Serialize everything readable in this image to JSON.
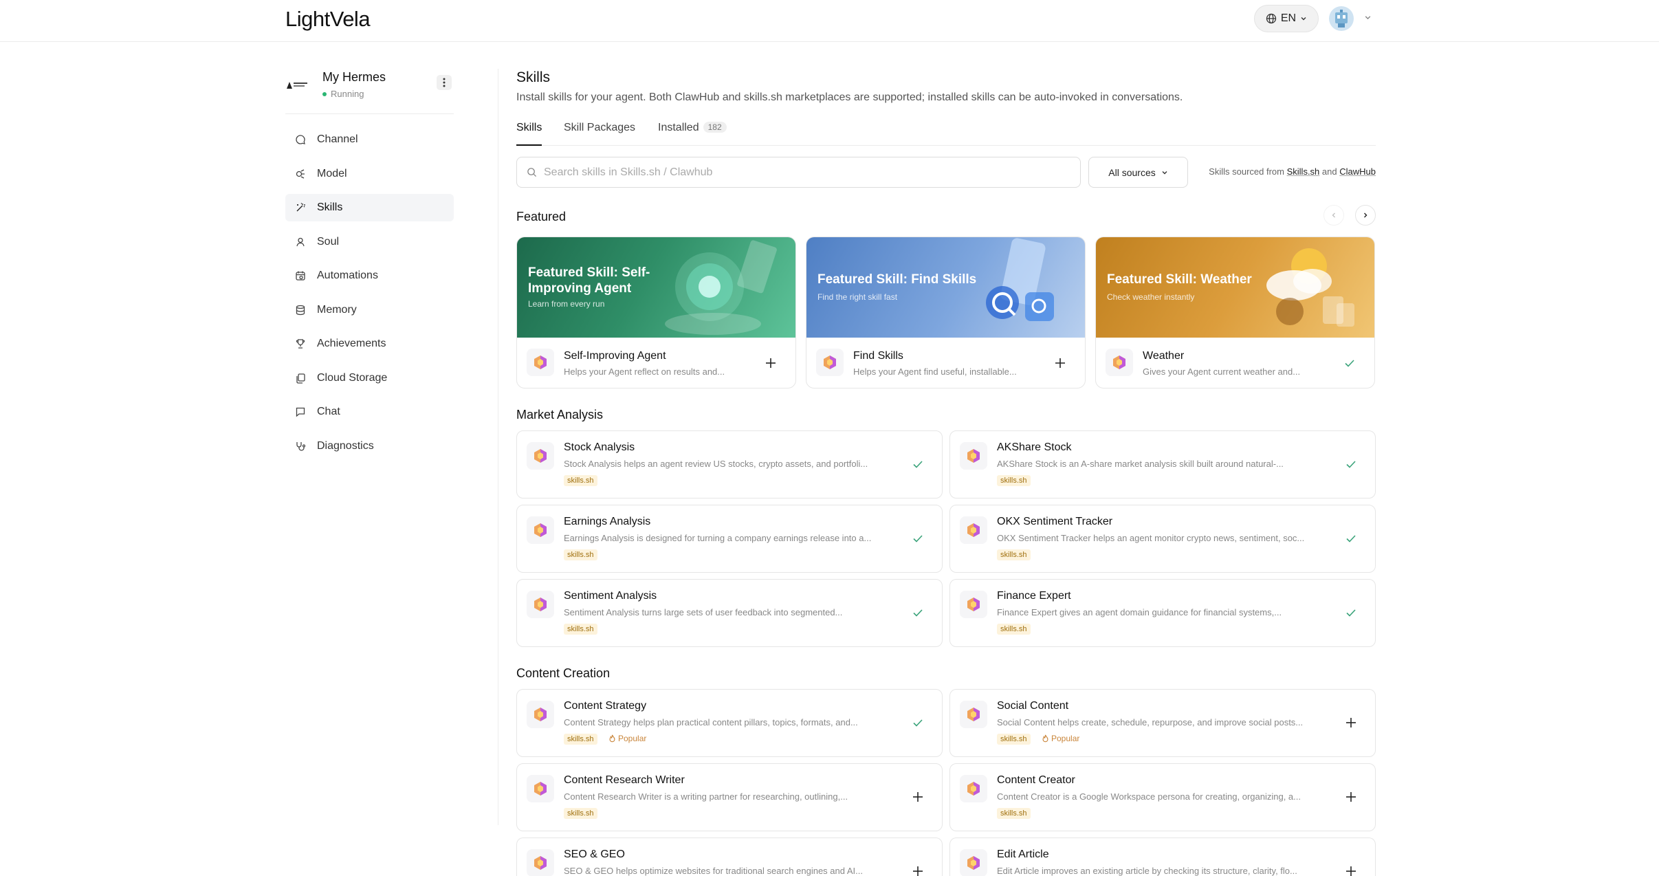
{
  "header": {
    "logo": "LightVela",
    "lang": "EN"
  },
  "sidebar": {
    "agent_name": "My Hermes",
    "agent_status": "Running",
    "items": [
      {
        "label": "Channel",
        "icon": "chat-bubble-icon"
      },
      {
        "label": "Model",
        "icon": "model-icon"
      },
      {
        "label": "Skills",
        "icon": "wand-icon"
      },
      {
        "label": "Soul",
        "icon": "person-icon"
      },
      {
        "label": "Automations",
        "icon": "calendar-clock-icon"
      },
      {
        "label": "Memory",
        "icon": "database-icon"
      },
      {
        "label": "Achievements",
        "icon": "trophy-icon"
      },
      {
        "label": "Cloud Storage",
        "icon": "cloud-files-icon"
      },
      {
        "label": "Chat",
        "icon": "message-square-icon"
      },
      {
        "label": "Diagnostics",
        "icon": "stethoscope-icon"
      }
    ],
    "active_index": 2
  },
  "main": {
    "title": "Skills",
    "description": "Install skills for your agent. Both ClawHub and skills.sh marketplaces are supported; installed skills can be auto-invoked in conversations.",
    "tabs": [
      {
        "label": "Skills"
      },
      {
        "label": "Skill Packages"
      },
      {
        "label": "Installed",
        "badge": "182"
      }
    ],
    "search_placeholder": "Search skills in Skills.sh / Clawhub",
    "sources_label": "All sources",
    "sources_note_prefix": "Skills sourced from",
    "sources_note_a": "Skills.sh",
    "sources_note_and": "and",
    "sources_note_b": "ClawHub"
  },
  "featured": {
    "title": "Featured",
    "cards": [
      {
        "banner_title": "Featured Skill: Self-Improving Agent",
        "banner_sub": "Learn from every run",
        "name": "Self-Improving Agent",
        "desc": "Helps your Agent reflect on results and...",
        "action": "add",
        "color_a": "#1f6b4e",
        "color_b": "#4fb38b"
      },
      {
        "banner_title": "Featured Skill: Find Skills",
        "banner_sub": "Find the right skill fast",
        "name": "Find Skills",
        "desc": "Helps your Agent find useful, installable...",
        "action": "add",
        "color_a": "#5b86c8",
        "color_b": "#a6c2ea"
      },
      {
        "banner_title": "Featured Skill: Weather",
        "banner_sub": "Check weather instantly",
        "name": "Weather",
        "desc": "Gives your Agent current weather and...",
        "action": "installed",
        "color_a": "#c98a2a",
        "color_b": "#f0c069"
      }
    ]
  },
  "market_analysis": {
    "title": "Market Analysis",
    "cards": [
      {
        "name": "Stock Analysis",
        "desc": "Stock Analysis helps an agent review US stocks, crypto assets, and portfoli...",
        "tag": "skills.sh",
        "action": "installed"
      },
      {
        "name": "AKShare Stock",
        "desc": "AKShare Stock is an A-share market analysis skill built around natural-...",
        "tag": "skills.sh",
        "action": "installed"
      },
      {
        "name": "Earnings Analysis",
        "desc": "Earnings Analysis is designed for turning a company earnings release into a...",
        "tag": "skills.sh",
        "action": "installed"
      },
      {
        "name": "OKX Sentiment Tracker",
        "desc": "OKX Sentiment Tracker helps an agent monitor crypto news, sentiment, soc...",
        "tag": "skills.sh",
        "action": "installed"
      },
      {
        "name": "Sentiment Analysis",
        "desc": "Sentiment Analysis turns large sets of user feedback into segmented...",
        "tag": "skills.sh",
        "action": "installed"
      },
      {
        "name": "Finance Expert",
        "desc": "Finance Expert gives an agent domain guidance for financial systems,...",
        "tag": "skills.sh",
        "action": "installed"
      }
    ]
  },
  "content_creation": {
    "title": "Content Creation",
    "cards": [
      {
        "name": "Content Strategy",
        "desc": "Content Strategy helps plan practical content pillars, topics, formats, and...",
        "tag": "skills.sh",
        "popular": "Popular",
        "action": "installed"
      },
      {
        "name": "Social Content",
        "desc": "Social Content helps create, schedule, repurpose, and improve social posts...",
        "tag": "skills.sh",
        "popular": "Popular",
        "action": "add"
      },
      {
        "name": "Content Research Writer",
        "desc": "Content Research Writer is a writing partner for researching, outlining,...",
        "tag": "skills.sh",
        "action": "add"
      },
      {
        "name": "Content Creator",
        "desc": "Content Creator is a Google Workspace persona for creating, organizing, a...",
        "tag": "skills.sh",
        "action": "add"
      },
      {
        "name": "SEO & GEO",
        "desc": "SEO & GEO helps optimize websites for traditional search engines and AI...",
        "action": "add"
      },
      {
        "name": "Edit Article",
        "desc": "Edit Article improves an existing article by checking its structure, clarity, flo...",
        "action": "add"
      }
    ]
  }
}
